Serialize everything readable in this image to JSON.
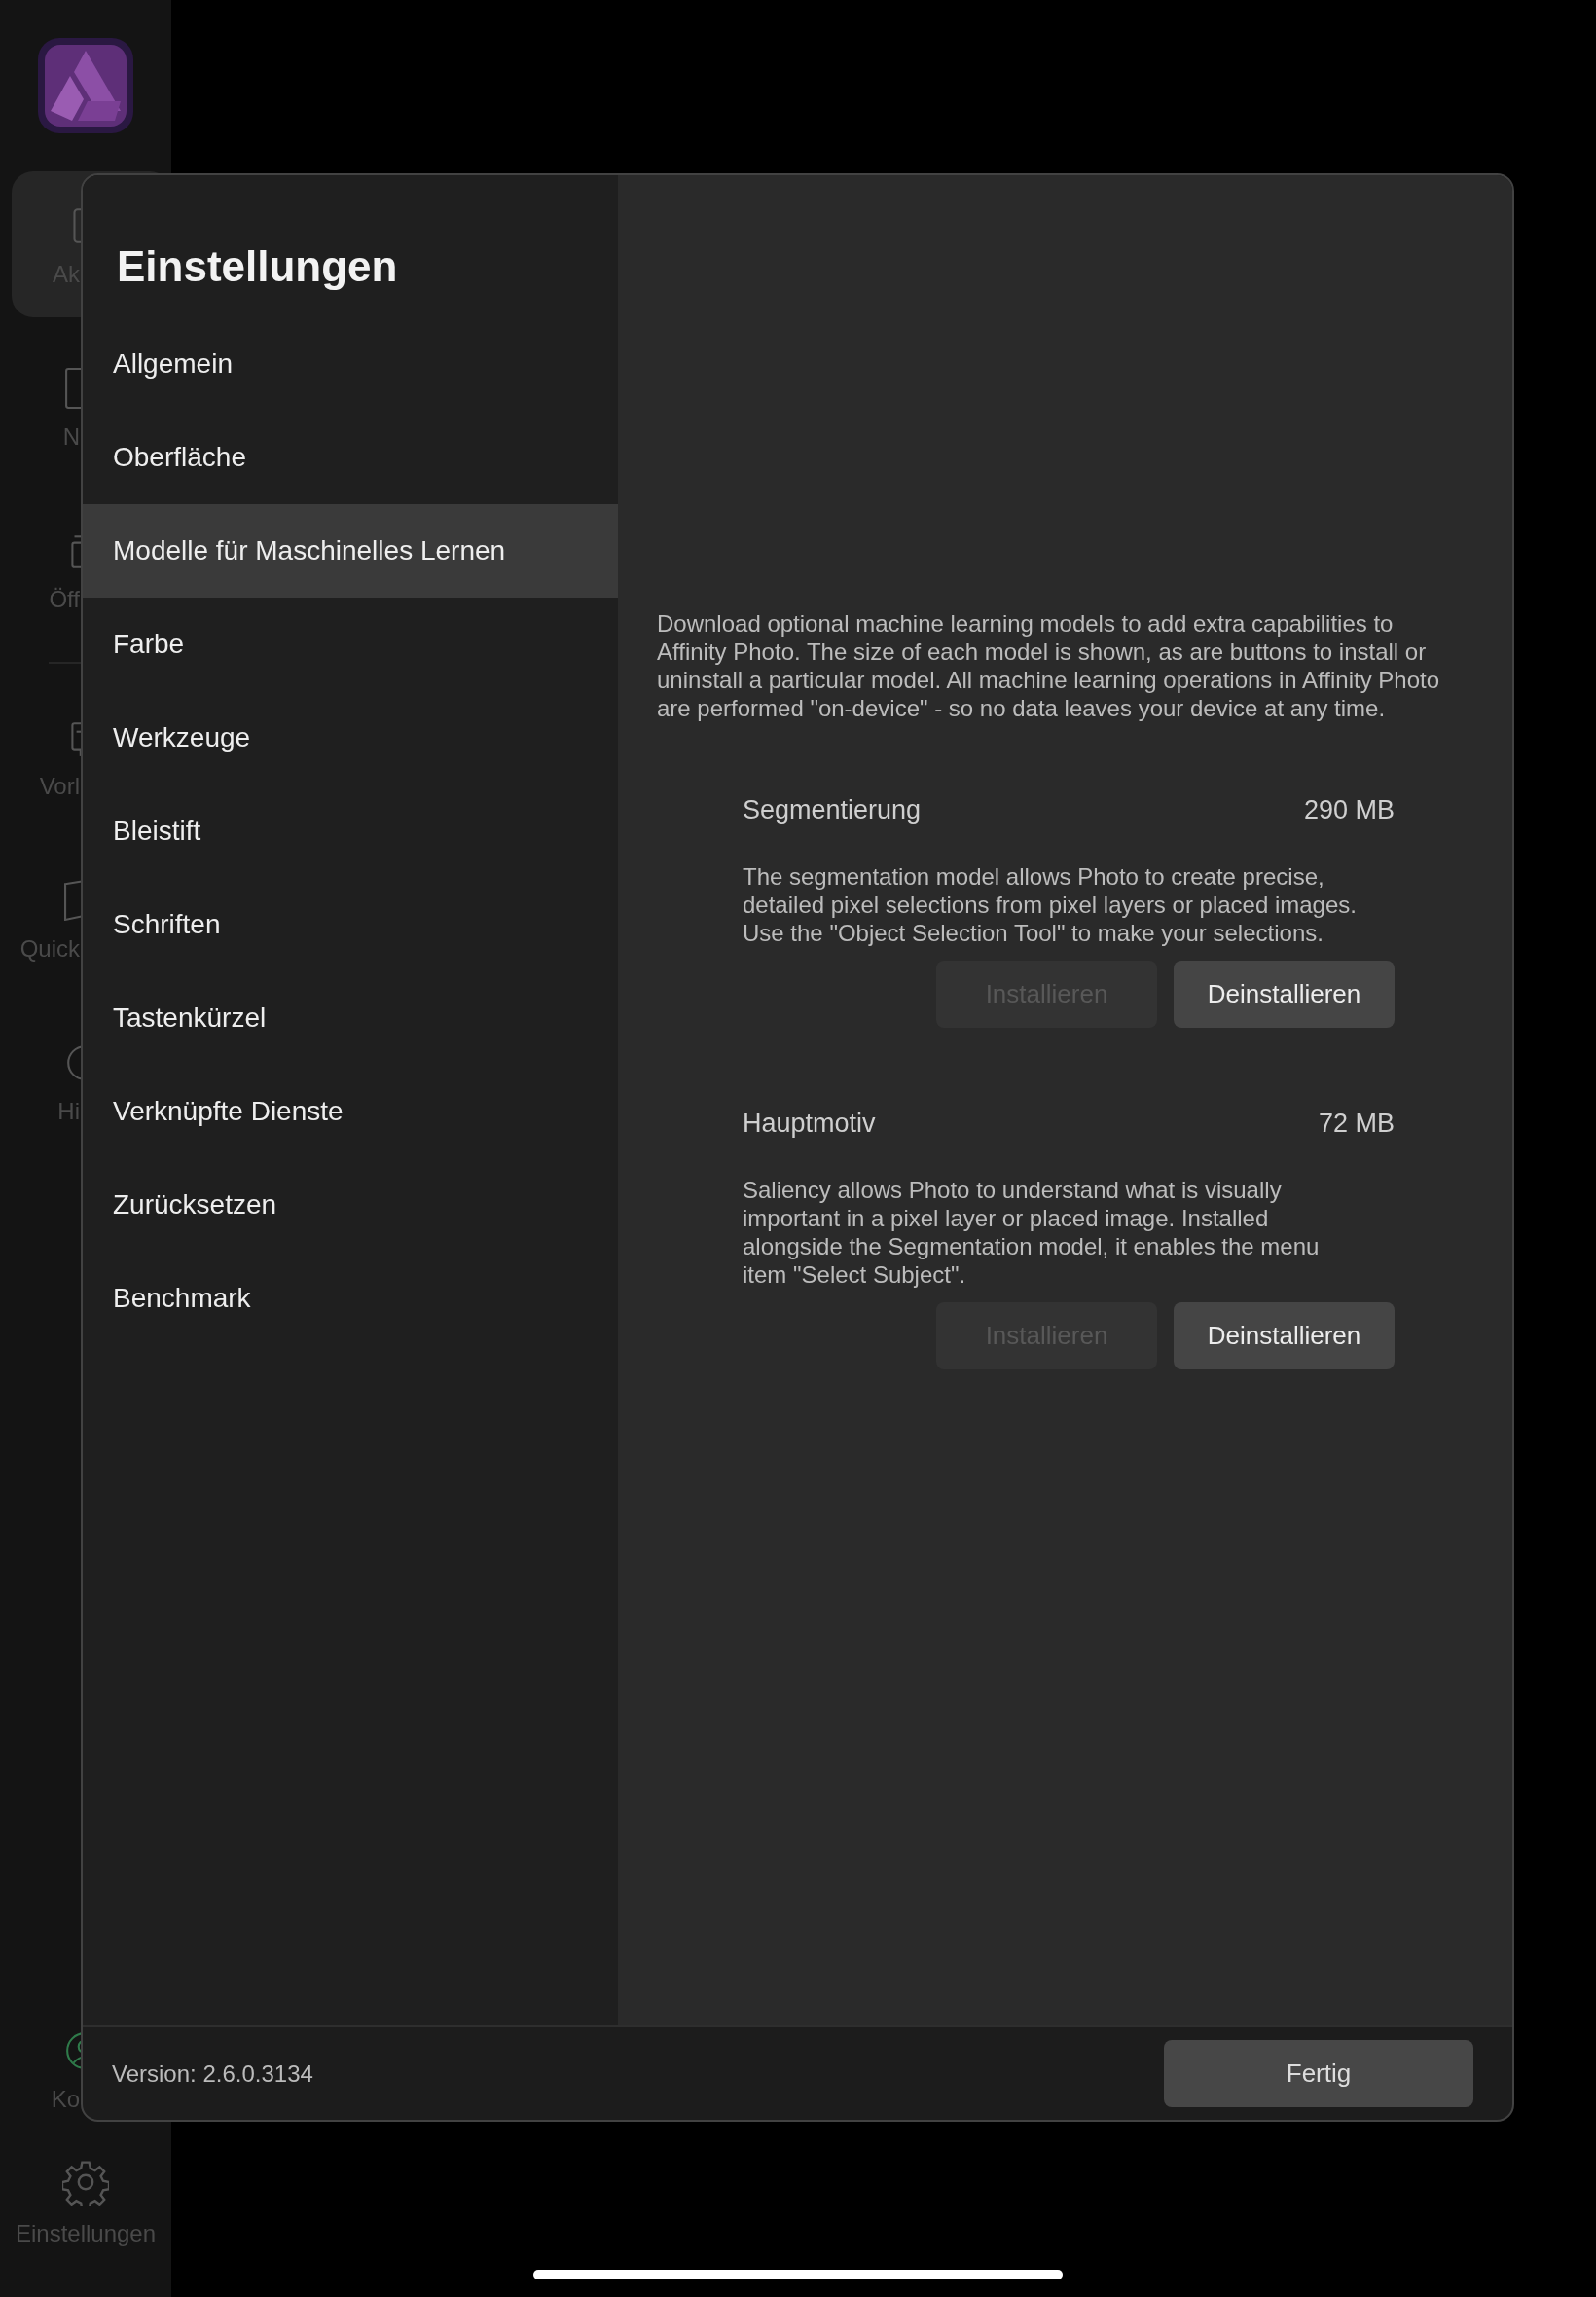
{
  "app_sidebar": {
    "items": [
      {
        "label": "Ak",
        "selected": true
      },
      {
        "label": "N",
        "selected": false
      },
      {
        "label": "Öff",
        "selected": false
      },
      {
        "label": "Vorl",
        "selected": false
      },
      {
        "label": "Quick",
        "selected": false
      },
      {
        "label": "Hi",
        "selected": false
      },
      {
        "label": "Ko",
        "selected": false
      }
    ],
    "settings_label": "Einstellungen"
  },
  "dialog": {
    "title": "Einstellungen",
    "nav": [
      {
        "label": "Allgemein",
        "selected": false
      },
      {
        "label": "Oberfläche",
        "selected": false
      },
      {
        "label": "Modelle für Maschinelles Lernen",
        "selected": true
      },
      {
        "label": "Farbe",
        "selected": false
      },
      {
        "label": "Werkzeuge",
        "selected": false
      },
      {
        "label": "Bleistift",
        "selected": false
      },
      {
        "label": "Schriften",
        "selected": false
      },
      {
        "label": "Tastenkürzel",
        "selected": false
      },
      {
        "label": "Verknüpfte Dienste",
        "selected": false
      },
      {
        "label": "Zurücksetzen",
        "selected": false
      },
      {
        "label": "Benchmark",
        "selected": false
      }
    ],
    "intro": "Download optional machine learning models to add extra capabilities to Affinity Photo. The size of each model is shown, as are buttons to install or uninstall a particular model. All machine learning operations in Affinity Photo are performed \"on-device\" - so no data leaves your device at any time.",
    "models": [
      {
        "name": "Segmentierung",
        "size": "290 MB",
        "description": "The segmentation model allows Photo to create precise, detailed pixel selections from pixel layers or placed images. Use the \"Object Selection Tool\" to make your selections.",
        "buttons": [
          {
            "label": "Installieren",
            "disabled": true
          },
          {
            "label": "Deinstallieren",
            "disabled": false
          }
        ]
      },
      {
        "name": "Hauptmotiv",
        "size": "72 MB",
        "description": "Saliency allows Photo to understand what is visually important in a pixel layer or placed image. Installed alongside the Segmentation model, it enables the menu item \"Select Subject\".",
        "buttons": [
          {
            "label": "Installieren",
            "disabled": true
          },
          {
            "label": "Deinstallieren",
            "disabled": false
          }
        ]
      }
    ],
    "version": "Version: 2.6.0.3134",
    "done_button": "Fertig"
  }
}
